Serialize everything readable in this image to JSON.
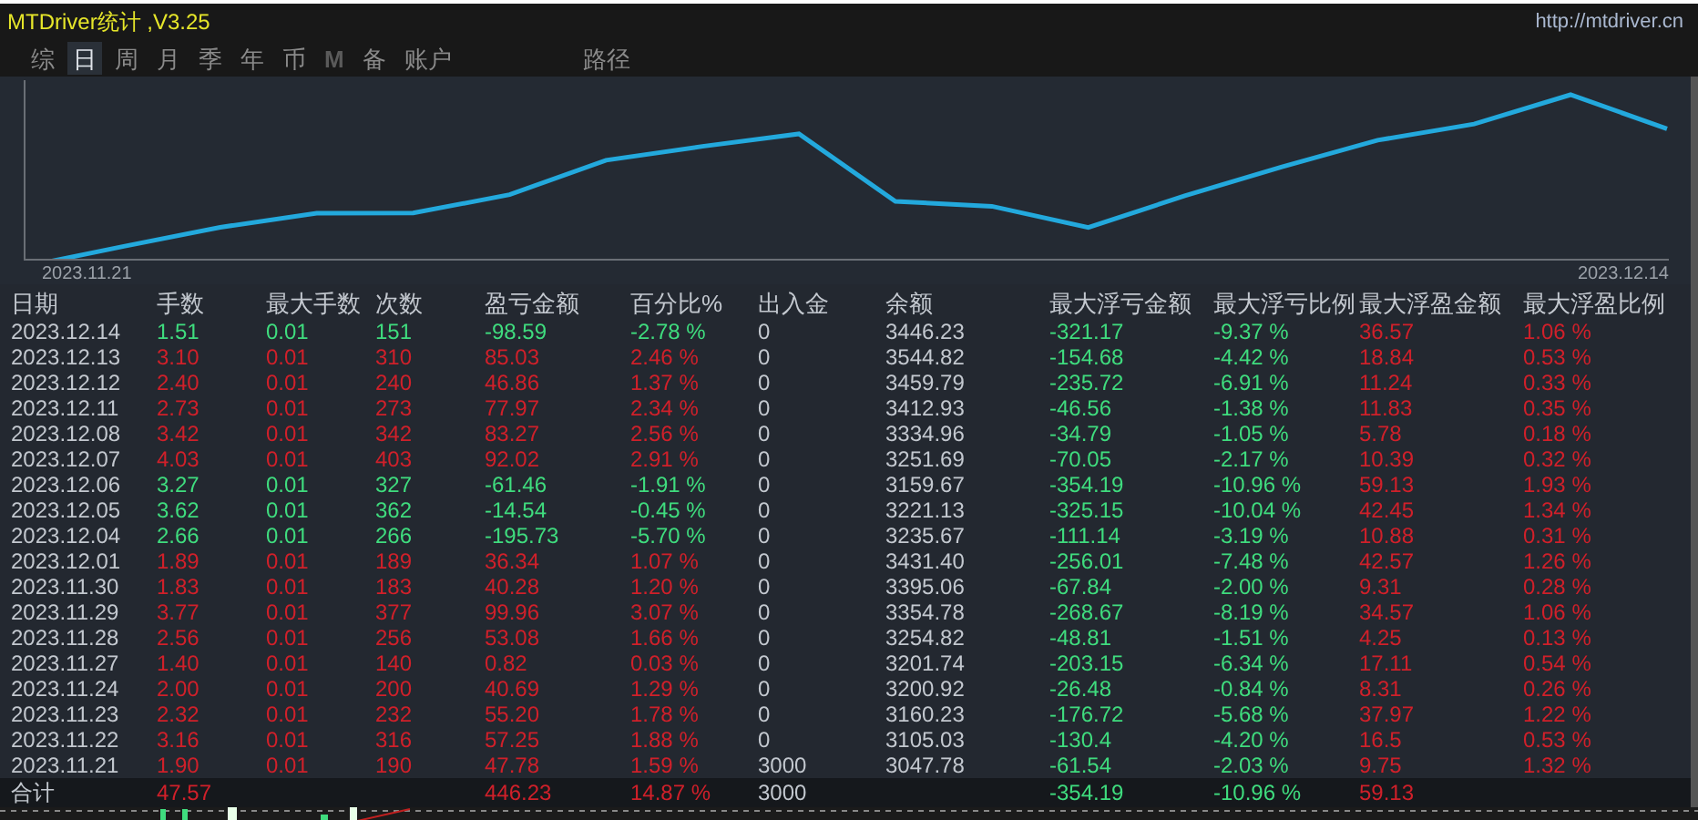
{
  "window": {
    "title": "MTDriver统计 ,V3.25",
    "link": "http://mtdriver.cn"
  },
  "tabs": [
    {
      "label": "综",
      "selected": false,
      "disabled": false
    },
    {
      "label": "日",
      "selected": true,
      "disabled": false
    },
    {
      "label": "周",
      "selected": false,
      "disabled": false
    },
    {
      "label": "月",
      "selected": false,
      "disabled": false
    },
    {
      "label": "季",
      "selected": false,
      "disabled": false
    },
    {
      "label": "年",
      "selected": false,
      "disabled": false
    },
    {
      "label": "币",
      "selected": false,
      "disabled": false
    },
    {
      "label": "M",
      "selected": false,
      "disabled": true
    },
    {
      "label": "备",
      "selected": false,
      "disabled": false
    },
    {
      "label": "账户",
      "selected": false,
      "disabled": false
    }
  ],
  "path_tab": {
    "label": "路径",
    "selected": false
  },
  "chart": {
    "start_label": "2023.11.21",
    "end_label": "2023.12.14"
  },
  "table": {
    "columns": [
      "日期",
      "手数",
      "最大手数",
      "次数",
      "盈亏金额",
      "百分比%",
      "出入金",
      "余额",
      "最大浮亏金额",
      "最大浮亏比例",
      "最大浮盈金额",
      "最大浮盈比例"
    ],
    "rows": [
      {
        "loss": true,
        "cells": [
          "2023.12.14",
          "1.51",
          "0.01",
          "151",
          "-98.59",
          "-2.78 %",
          "0",
          "3446.23",
          "-321.17",
          "-9.37 %",
          "36.57",
          "1.06 %"
        ]
      },
      {
        "loss": false,
        "cells": [
          "2023.12.13",
          "3.10",
          "0.01",
          "310",
          "85.03",
          "2.46 %",
          "0",
          "3544.82",
          "-154.68",
          "-4.42 %",
          "18.84",
          "0.53 %"
        ]
      },
      {
        "loss": false,
        "cells": [
          "2023.12.12",
          "2.40",
          "0.01",
          "240",
          "46.86",
          "1.37 %",
          "0",
          "3459.79",
          "-235.72",
          "-6.91 %",
          "11.24",
          "0.33 %"
        ]
      },
      {
        "loss": false,
        "cells": [
          "2023.12.11",
          "2.73",
          "0.01",
          "273",
          "77.97",
          "2.34 %",
          "0",
          "3412.93",
          "-46.56",
          "-1.38 %",
          "11.83",
          "0.35 %"
        ]
      },
      {
        "loss": false,
        "cells": [
          "2023.12.08",
          "3.42",
          "0.01",
          "342",
          "83.27",
          "2.56 %",
          "0",
          "3334.96",
          "-34.79",
          "-1.05 %",
          "5.78",
          "0.18 %"
        ]
      },
      {
        "loss": false,
        "cells": [
          "2023.12.07",
          "4.03",
          "0.01",
          "403",
          "92.02",
          "2.91 %",
          "0",
          "3251.69",
          "-70.05",
          "-2.17 %",
          "10.39",
          "0.32 %"
        ]
      },
      {
        "loss": true,
        "cells": [
          "2023.12.06",
          "3.27",
          "0.01",
          "327",
          "-61.46",
          "-1.91 %",
          "0",
          "3159.67",
          "-354.19",
          "-10.96 %",
          "59.13",
          "1.93 %"
        ]
      },
      {
        "loss": true,
        "cells": [
          "2023.12.05",
          "3.62",
          "0.01",
          "362",
          "-14.54",
          "-0.45 %",
          "0",
          "3221.13",
          "-325.15",
          "-10.04 %",
          "42.45",
          "1.34 %"
        ]
      },
      {
        "loss": true,
        "cells": [
          "2023.12.04",
          "2.66",
          "0.01",
          "266",
          "-195.73",
          "-5.70 %",
          "0",
          "3235.67",
          "-111.14",
          "-3.19 %",
          "10.88",
          "0.31 %"
        ]
      },
      {
        "loss": false,
        "cells": [
          "2023.12.01",
          "1.89",
          "0.01",
          "189",
          "36.34",
          "1.07 %",
          "0",
          "3431.40",
          "-256.01",
          "-7.48 %",
          "42.57",
          "1.26 %"
        ]
      },
      {
        "loss": false,
        "cells": [
          "2023.11.30",
          "1.83",
          "0.01",
          "183",
          "40.28",
          "1.20 %",
          "0",
          "3395.06",
          "-67.84",
          "-2.00 %",
          "9.31",
          "0.28 %"
        ]
      },
      {
        "loss": false,
        "cells": [
          "2023.11.29",
          "3.77",
          "0.01",
          "377",
          "99.96",
          "3.07 %",
          "0",
          "3354.78",
          "-268.67",
          "-8.19 %",
          "34.57",
          "1.06 %"
        ]
      },
      {
        "loss": false,
        "cells": [
          "2023.11.28",
          "2.56",
          "0.01",
          "256",
          "53.08",
          "1.66 %",
          "0",
          "3254.82",
          "-48.81",
          "-1.51 %",
          "4.25",
          "0.13 %"
        ]
      },
      {
        "loss": false,
        "cells": [
          "2023.11.27",
          "1.40",
          "0.01",
          "140",
          "0.82",
          "0.03 %",
          "0",
          "3201.74",
          "-203.15",
          "-6.34 %",
          "17.11",
          "0.54 %"
        ]
      },
      {
        "loss": false,
        "cells": [
          "2023.11.24",
          "2.00",
          "0.01",
          "200",
          "40.69",
          "1.29 %",
          "0",
          "3200.92",
          "-26.48",
          "-0.84 %",
          "8.31",
          "0.26 %"
        ]
      },
      {
        "loss": false,
        "cells": [
          "2023.11.23",
          "2.32",
          "0.01",
          "232",
          "55.20",
          "1.78 %",
          "0",
          "3160.23",
          "-176.72",
          "-5.68 %",
          "37.97",
          "1.22 %"
        ]
      },
      {
        "loss": false,
        "cells": [
          "2023.11.22",
          "3.16",
          "0.01",
          "316",
          "57.25",
          "1.88 %",
          "0",
          "3105.03",
          "-130.4",
          "-4.20 %",
          "16.5",
          "0.53 %"
        ]
      },
      {
        "loss": false,
        "cells": [
          "2023.11.21",
          "1.90",
          "0.01",
          "190",
          "47.78",
          "1.59 %",
          "3000",
          "3047.78",
          "-61.54",
          "-2.03 %",
          "9.75",
          "1.32 %"
        ]
      }
    ],
    "total": {
      "loss": false,
      "cells": [
        "合计",
        "47.57",
        "",
        "",
        "446.23",
        "14.87 %",
        "3000",
        "",
        "-354.19",
        "-10.96 %",
        "59.13",
        ""
      ]
    }
  }
}
